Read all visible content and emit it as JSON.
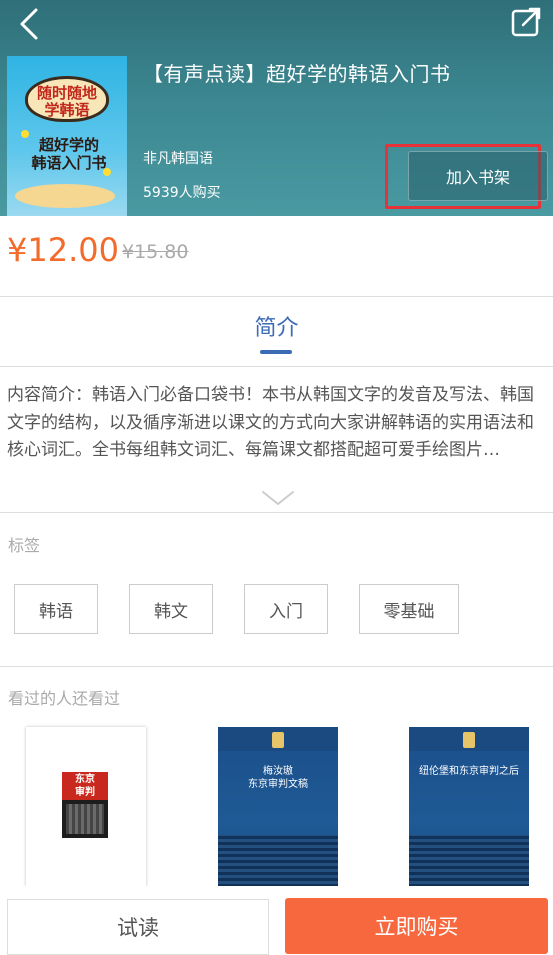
{
  "header": {
    "back_icon": "chevron-left-icon",
    "share_icon": "share-external-icon",
    "title": "【有声点读】超好学的韩语入门书",
    "publisher": "非凡韩国语",
    "buyers": "5939人购买",
    "add_to_shelf": "加入书架",
    "highlight_color": "#e8323a"
  },
  "cover": {
    "chip_text": "随时随地\n学韩语",
    "sub_text": "超好学的\n韩语入门书"
  },
  "pricing": {
    "price": "¥12.00",
    "original_price": "¥15.80",
    "price_color": "#f36b2a"
  },
  "tabs": {
    "intro": "简介",
    "accent_color": "#3c6bb5"
  },
  "summary": {
    "text": "内容简介：韩语入门必备口袋书！本书从韩国文字的发音及写法、韩国文字的结构，以及循序渐进以课文的方式向大家讲解韩语的实用语法和核心词汇。全书每组韩文词汇、每篇课文都搭配超可爱手绘图片…"
  },
  "tags": {
    "label": "标签",
    "items": [
      "韩语",
      "韩文",
      "入门",
      "零基础"
    ]
  },
  "recommended": {
    "label": "看过的人还看过",
    "books": [
      {
        "cover_text": "东京\n审判"
      },
      {
        "cover_text": "梅汝璈\n东京审判文稿"
      },
      {
        "cover_text": "纽伦堡和东京审判之后"
      }
    ]
  },
  "actions": {
    "try_read": "试读",
    "buy_now": "立即购买",
    "buy_color": "#f7683f"
  }
}
